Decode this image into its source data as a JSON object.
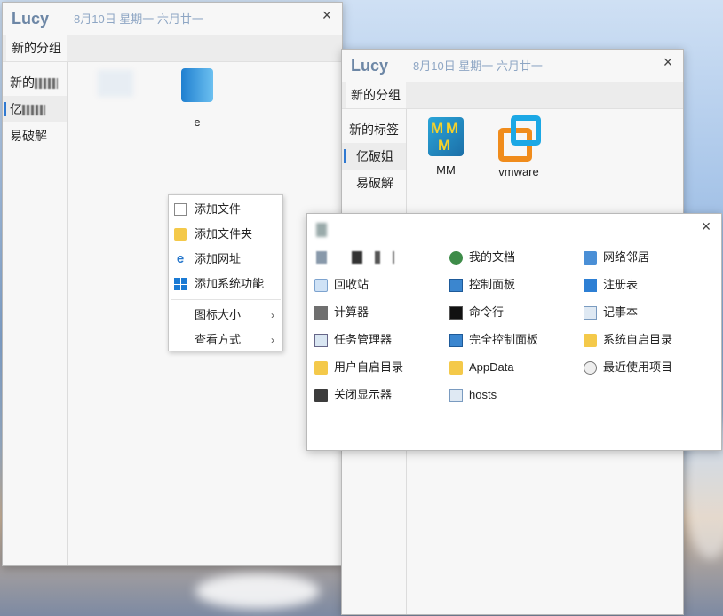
{
  "window1": {
    "app_title": "Lucy",
    "date": "8月10日 星期一 六月廿一",
    "close_label": "×",
    "tab_label": "新的分组",
    "side_items": [
      "新的",
      "亿",
      "易破解"
    ],
    "tiles": [
      {
        "label": ""
      },
      {
        "label": "e"
      }
    ]
  },
  "window2": {
    "app_title": "Lucy",
    "date": "8月10日 星期一 六月廿一",
    "close_label": "×",
    "tab_label": "新的分组",
    "side_items": [
      "新的标签",
      "亿破姐",
      "易破解"
    ],
    "tiles": [
      {
        "label": "MM"
      },
      {
        "label": "vmware"
      }
    ]
  },
  "context_menu": {
    "items": [
      "添加文件",
      "添加文件夹",
      "添加网址",
      "添加系统功能"
    ],
    "submenus": [
      "图标大小",
      "查看方式"
    ],
    "arrow": "›"
  },
  "tools_window": {
    "close_label": "×",
    "tools": [
      {
        "label": "我的文档",
        "icon": "user-docs-icon"
      },
      {
        "label": "网络邻居",
        "icon": "network-icon"
      },
      {
        "label": "回收站",
        "icon": "recycle-bin-icon"
      },
      {
        "label": "控制面板",
        "icon": "control-panel-icon"
      },
      {
        "label": "注册表",
        "icon": "registry-icon"
      },
      {
        "label": "计算器",
        "icon": "calculator-icon"
      },
      {
        "label": "命令行",
        "icon": "cmd-icon"
      },
      {
        "label": "记事本",
        "icon": "notepad-icon"
      },
      {
        "label": "任务管理器",
        "icon": "task-manager-icon"
      },
      {
        "label": "完全控制面板",
        "icon": "full-control-panel-icon"
      },
      {
        "label": "系统自启目录",
        "icon": "folder-icon"
      },
      {
        "label": "用户自启目录",
        "icon": "folder-icon"
      },
      {
        "label": "AppData",
        "icon": "folder-icon"
      },
      {
        "label": "最近使用项目",
        "icon": "recent-items-icon"
      },
      {
        "label": "关闭显示器",
        "icon": "monitor-icon"
      },
      {
        "label": "hosts",
        "icon": "hosts-file-icon"
      }
    ]
  },
  "colors": {
    "accent": "#2f79d1",
    "title": "#6d87a6",
    "date": "#8ea6c4"
  }
}
